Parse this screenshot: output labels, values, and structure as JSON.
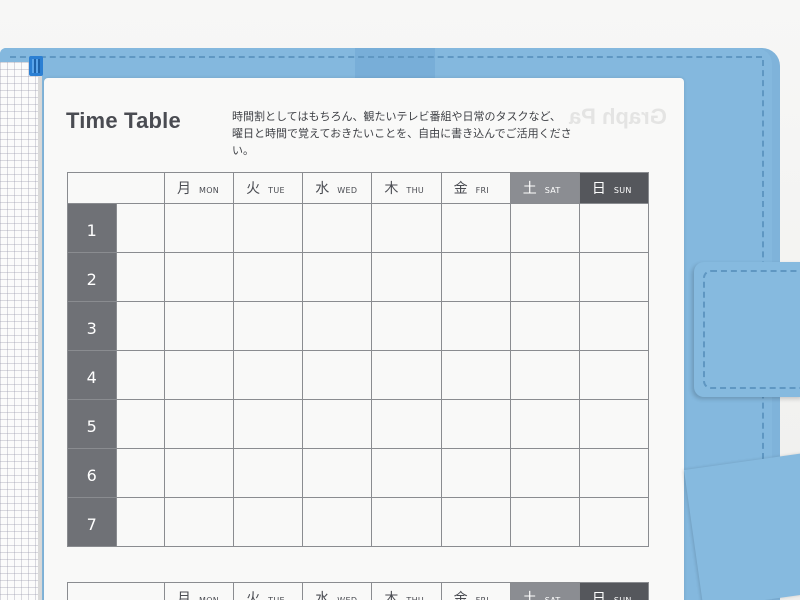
{
  "page": {
    "title": "Time Table",
    "description_line1": "時間割としてはもちろん、観たいテレビ番組や日常のタスクなど、",
    "description_line2": "曜日と時間で覚えておきたいことを、自由に書き込んでご活用ください。"
  },
  "timetable": {
    "days": [
      {
        "jp": "月",
        "en": "MON"
      },
      {
        "jp": "火",
        "en": "TUE"
      },
      {
        "jp": "水",
        "en": "WED"
      },
      {
        "jp": "木",
        "en": "THU"
      },
      {
        "jp": "金",
        "en": "FRI"
      },
      {
        "jp": "土",
        "en": "SAT"
      },
      {
        "jp": "日",
        "en": "SUN"
      }
    ],
    "periods": [
      "1",
      "2",
      "3",
      "4",
      "5",
      "6",
      "7"
    ]
  },
  "colors": {
    "cover": "#84b8de",
    "saturday_header": "#8b8d92",
    "sunday_header": "#55575c",
    "period_column": "#6f7176"
  }
}
